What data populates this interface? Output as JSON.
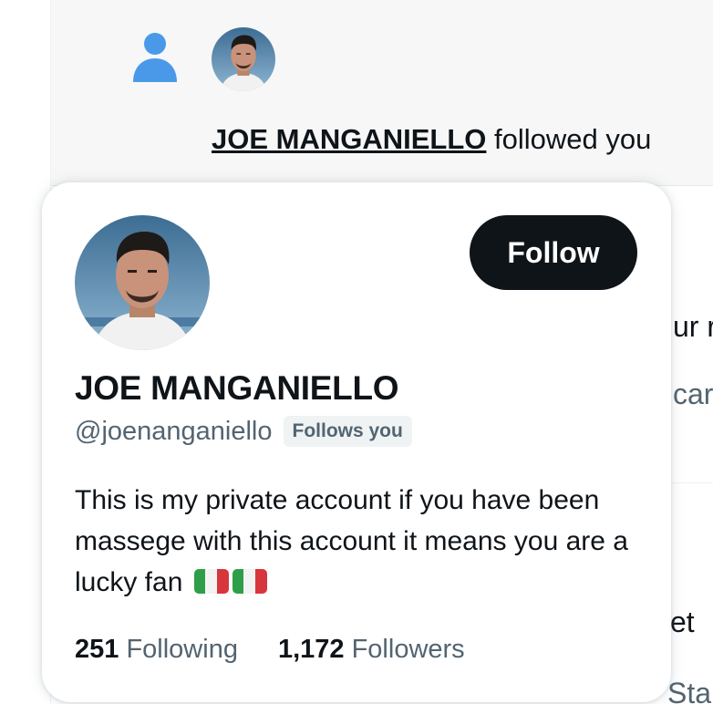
{
  "notification": {
    "icon": "person-icon",
    "name": "JOE MANGANIELLO",
    "action": " followed you"
  },
  "background": {
    "fragment_1": "ur r",
    "fragment_2": "car",
    "fragment_3": "et",
    "fragment_4": "Sta"
  },
  "hover_card": {
    "follow_label": "Follow",
    "display_name": "JOE MANGANIELLO",
    "handle": "@joenanganiello",
    "follows_badge": "Follows you",
    "bio": "This is my private account if you have been massege with this account it means you are a lucky fan",
    "bio_emoji": [
      "flag-italy",
      "flag-italy"
    ],
    "following_count": "251",
    "following_label": "Following",
    "followers_count": "1,172",
    "followers_label": "Followers"
  },
  "colors": {
    "accent_blue": "#4a99e9",
    "button_black": "#0f1419",
    "secondary_text": "#536471",
    "flag_green": "#2f9e49",
    "flag_white": "#f3f3f3",
    "flag_red": "#d7363d"
  }
}
